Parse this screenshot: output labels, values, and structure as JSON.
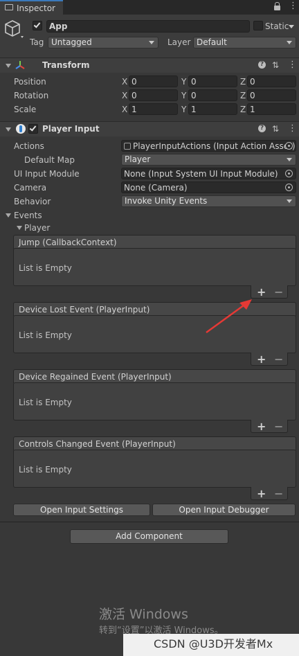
{
  "window": {
    "tab_title": "Inspector",
    "lock_icon": "lock-icon",
    "menu_icon": "kebab-menu-icon"
  },
  "object": {
    "name": "App",
    "active": true,
    "static_label": "Static",
    "tag_label": "Tag",
    "tag_value": "Untagged",
    "layer_label": "Layer",
    "layer_value": "Default"
  },
  "transform": {
    "title": "Transform",
    "rows": [
      {
        "label": "Position",
        "x": "0",
        "y": "0",
        "z": "0"
      },
      {
        "label": "Rotation",
        "x": "0",
        "y": "0",
        "z": "0"
      },
      {
        "label": "Scale",
        "x": "1",
        "y": "1",
        "z": "1"
      }
    ],
    "axes": [
      "X",
      "Y",
      "Z"
    ]
  },
  "player_input": {
    "title": "Player Input",
    "enabled": true,
    "actions_label": "Actions",
    "actions_value": "PlayerInputActions (Input Action Asset)",
    "default_map_label": "Default Map",
    "default_map_value": "Player",
    "ui_module_label": "UI Input Module",
    "ui_module_value": "None (Input System UI Input Module)",
    "camera_label": "Camera",
    "camera_value": "None (Camera)",
    "behavior_label": "Behavior",
    "behavior_value": "Invoke Unity Events",
    "events_label": "Events",
    "player_label": "Player",
    "events": [
      {
        "title": "Jump (CallbackContext)",
        "empty": "List is Empty"
      },
      {
        "title": "Device Lost Event (PlayerInput)",
        "empty": "List is Empty"
      },
      {
        "title": "Device Regained Event (PlayerInput)",
        "empty": "List is Empty"
      },
      {
        "title": "Controls Changed Event (PlayerInput)",
        "empty": "List is Empty"
      }
    ],
    "plus": "+",
    "minus": "−",
    "open_settings_button": "Open Input Settings",
    "open_debugger_button": "Open Input Debugger"
  },
  "add_component_button": "Add Component",
  "watermark": {
    "line1": "激活 Windows",
    "line2": "转到“设置”以激活 Windows。",
    "credit": "CSDN @U3D开发者Mx"
  },
  "colors": {
    "accent": "#3a79bb",
    "annotation_arrow": "#e53935"
  }
}
